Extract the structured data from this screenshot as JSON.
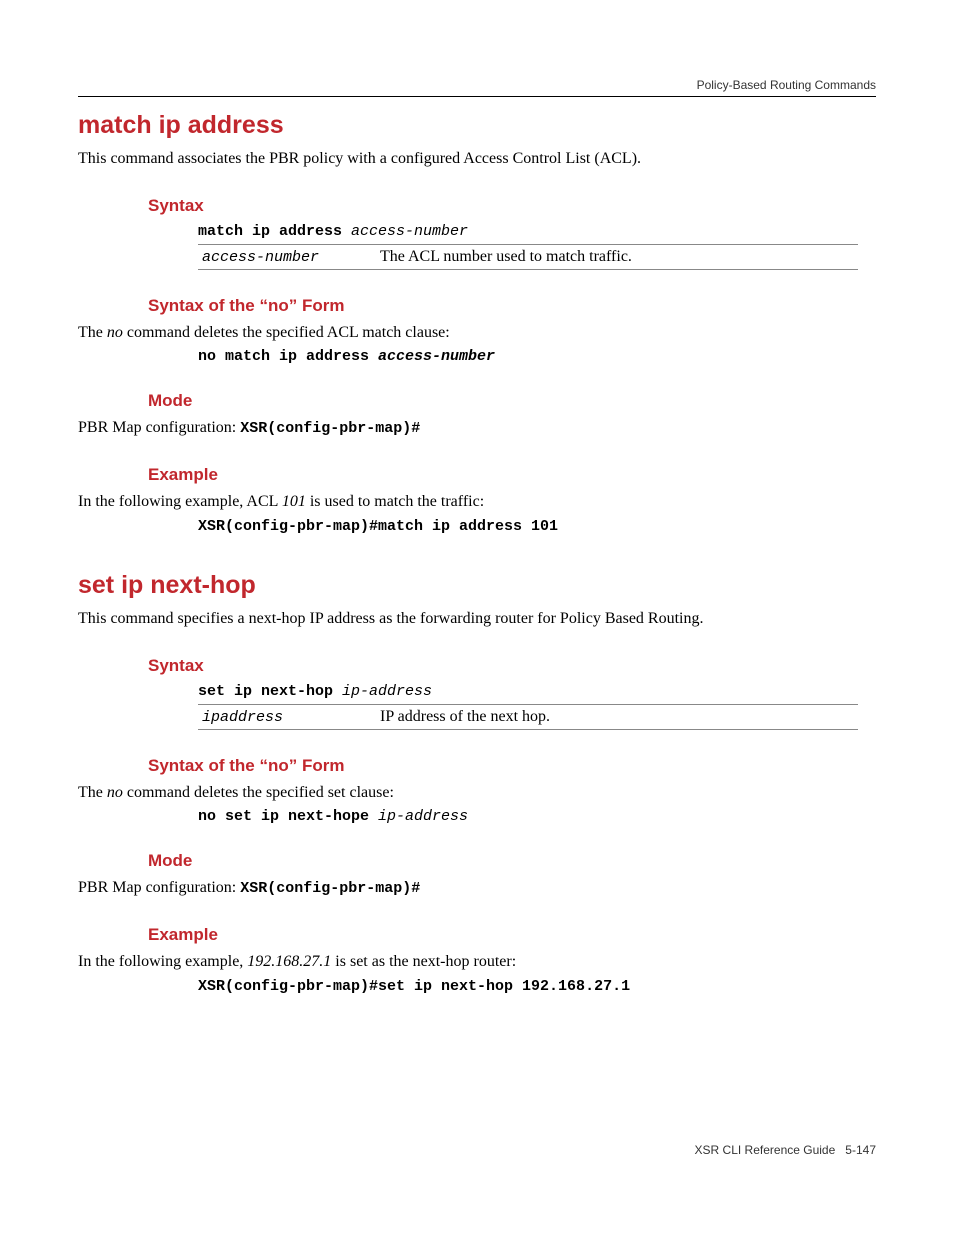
{
  "header": {
    "running": "Policy-Based Routing Commands"
  },
  "cmd1": {
    "title": "match ip address",
    "intro": "This command associates the PBR policy with a configured Access Control List (ACL).",
    "syntax_heading": "Syntax",
    "syntax_cmd": "match ip address ",
    "syntax_arg": "access-number",
    "param_name": "access-number",
    "param_desc": "The ACL number used to match traffic.",
    "noform_heading": "Syntax of the “no” Form",
    "noform_pre": "The ",
    "noform_no": "no",
    "noform_post": " command deletes the specified ACL match clause:",
    "noform_cmd": "no match ip address ",
    "noform_arg": "access-number",
    "mode_heading": "Mode",
    "mode_pre": "PBR Map configuration: ",
    "mode_prompt": "XSR(config-pbr-map)#",
    "example_heading": "Example",
    "example_pre": "In the following example, ACL ",
    "example_ital": "101",
    "example_post": " is used to match the traffic:",
    "example_cmd": "XSR(config-pbr-map)#match ip address 101"
  },
  "cmd2": {
    "title": "set ip next-hop",
    "intro": "This command specifies a next-hop IP address as the forwarding router for Policy Based Routing.",
    "syntax_heading": "Syntax",
    "syntax_cmd": "set ip next-hop ",
    "syntax_arg": "ip-address",
    "param_name": "ipaddress",
    "param_desc": "IP address of the next hop.",
    "noform_heading": "Syntax of the “no” Form",
    "noform_pre": "The ",
    "noform_no": "no",
    "noform_post": " command deletes the specified set clause:",
    "noform_cmd": "no set ip next-hope ",
    "noform_arg": "ip-address",
    "mode_heading": "Mode",
    "mode_pre": "PBR Map configuration: ",
    "mode_prompt": "XSR(config-pbr-map)#",
    "example_heading": "Example",
    "example_pre": "In the following example, ",
    "example_ital": "192.168.27.1",
    "example_post": " is set as the next-hop router:",
    "example_cmd": "XSR(config-pbr-map)#set ip next-hop 192.168.27.1"
  },
  "footer": {
    "doc": "XSR CLI Reference Guide",
    "page": "5-147"
  }
}
